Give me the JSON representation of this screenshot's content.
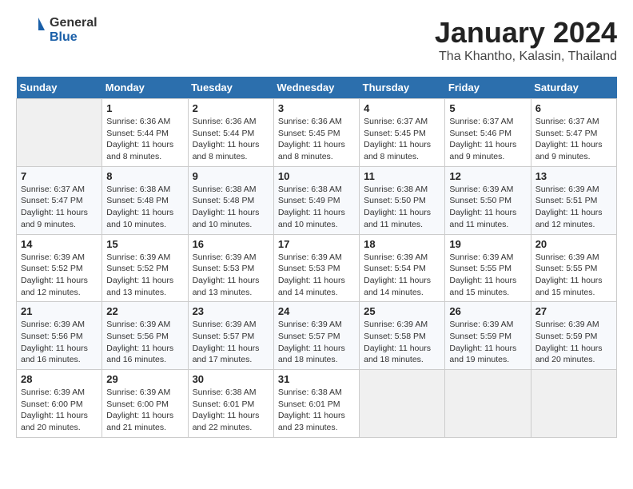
{
  "header": {
    "logo_general": "General",
    "logo_blue": "Blue",
    "title": "January 2024",
    "location": "Tha Khantho, Kalasin, Thailand"
  },
  "days_of_week": [
    "Sunday",
    "Monday",
    "Tuesday",
    "Wednesday",
    "Thursday",
    "Friday",
    "Saturday"
  ],
  "weeks": [
    [
      {
        "day": "",
        "info": ""
      },
      {
        "day": "1",
        "info": "Sunrise: 6:36 AM\nSunset: 5:44 PM\nDaylight: 11 hours\nand 8 minutes."
      },
      {
        "day": "2",
        "info": "Sunrise: 6:36 AM\nSunset: 5:44 PM\nDaylight: 11 hours\nand 8 minutes."
      },
      {
        "day": "3",
        "info": "Sunrise: 6:36 AM\nSunset: 5:45 PM\nDaylight: 11 hours\nand 8 minutes."
      },
      {
        "day": "4",
        "info": "Sunrise: 6:37 AM\nSunset: 5:45 PM\nDaylight: 11 hours\nand 8 minutes."
      },
      {
        "day": "5",
        "info": "Sunrise: 6:37 AM\nSunset: 5:46 PM\nDaylight: 11 hours\nand 9 minutes."
      },
      {
        "day": "6",
        "info": "Sunrise: 6:37 AM\nSunset: 5:47 PM\nDaylight: 11 hours\nand 9 minutes."
      }
    ],
    [
      {
        "day": "7",
        "info": "Sunrise: 6:37 AM\nSunset: 5:47 PM\nDaylight: 11 hours\nand 9 minutes."
      },
      {
        "day": "8",
        "info": "Sunrise: 6:38 AM\nSunset: 5:48 PM\nDaylight: 11 hours\nand 10 minutes."
      },
      {
        "day": "9",
        "info": "Sunrise: 6:38 AM\nSunset: 5:48 PM\nDaylight: 11 hours\nand 10 minutes."
      },
      {
        "day": "10",
        "info": "Sunrise: 6:38 AM\nSunset: 5:49 PM\nDaylight: 11 hours\nand 10 minutes."
      },
      {
        "day": "11",
        "info": "Sunrise: 6:38 AM\nSunset: 5:50 PM\nDaylight: 11 hours\nand 11 minutes."
      },
      {
        "day": "12",
        "info": "Sunrise: 6:39 AM\nSunset: 5:50 PM\nDaylight: 11 hours\nand 11 minutes."
      },
      {
        "day": "13",
        "info": "Sunrise: 6:39 AM\nSunset: 5:51 PM\nDaylight: 11 hours\nand 12 minutes."
      }
    ],
    [
      {
        "day": "14",
        "info": "Sunrise: 6:39 AM\nSunset: 5:52 PM\nDaylight: 11 hours\nand 12 minutes."
      },
      {
        "day": "15",
        "info": "Sunrise: 6:39 AM\nSunset: 5:52 PM\nDaylight: 11 hours\nand 13 minutes."
      },
      {
        "day": "16",
        "info": "Sunrise: 6:39 AM\nSunset: 5:53 PM\nDaylight: 11 hours\nand 13 minutes."
      },
      {
        "day": "17",
        "info": "Sunrise: 6:39 AM\nSunset: 5:53 PM\nDaylight: 11 hours\nand 14 minutes."
      },
      {
        "day": "18",
        "info": "Sunrise: 6:39 AM\nSunset: 5:54 PM\nDaylight: 11 hours\nand 14 minutes."
      },
      {
        "day": "19",
        "info": "Sunrise: 6:39 AM\nSunset: 5:55 PM\nDaylight: 11 hours\nand 15 minutes."
      },
      {
        "day": "20",
        "info": "Sunrise: 6:39 AM\nSunset: 5:55 PM\nDaylight: 11 hours\nand 15 minutes."
      }
    ],
    [
      {
        "day": "21",
        "info": "Sunrise: 6:39 AM\nSunset: 5:56 PM\nDaylight: 11 hours\nand 16 minutes."
      },
      {
        "day": "22",
        "info": "Sunrise: 6:39 AM\nSunset: 5:56 PM\nDaylight: 11 hours\nand 16 minutes."
      },
      {
        "day": "23",
        "info": "Sunrise: 6:39 AM\nSunset: 5:57 PM\nDaylight: 11 hours\nand 17 minutes."
      },
      {
        "day": "24",
        "info": "Sunrise: 6:39 AM\nSunset: 5:57 PM\nDaylight: 11 hours\nand 18 minutes."
      },
      {
        "day": "25",
        "info": "Sunrise: 6:39 AM\nSunset: 5:58 PM\nDaylight: 11 hours\nand 18 minutes."
      },
      {
        "day": "26",
        "info": "Sunrise: 6:39 AM\nSunset: 5:59 PM\nDaylight: 11 hours\nand 19 minutes."
      },
      {
        "day": "27",
        "info": "Sunrise: 6:39 AM\nSunset: 5:59 PM\nDaylight: 11 hours\nand 20 minutes."
      }
    ],
    [
      {
        "day": "28",
        "info": "Sunrise: 6:39 AM\nSunset: 6:00 PM\nDaylight: 11 hours\nand 20 minutes."
      },
      {
        "day": "29",
        "info": "Sunrise: 6:39 AM\nSunset: 6:00 PM\nDaylight: 11 hours\nand 21 minutes."
      },
      {
        "day": "30",
        "info": "Sunrise: 6:38 AM\nSunset: 6:01 PM\nDaylight: 11 hours\nand 22 minutes."
      },
      {
        "day": "31",
        "info": "Sunrise: 6:38 AM\nSunset: 6:01 PM\nDaylight: 11 hours\nand 23 minutes."
      },
      {
        "day": "",
        "info": ""
      },
      {
        "day": "",
        "info": ""
      },
      {
        "day": "",
        "info": ""
      }
    ]
  ]
}
